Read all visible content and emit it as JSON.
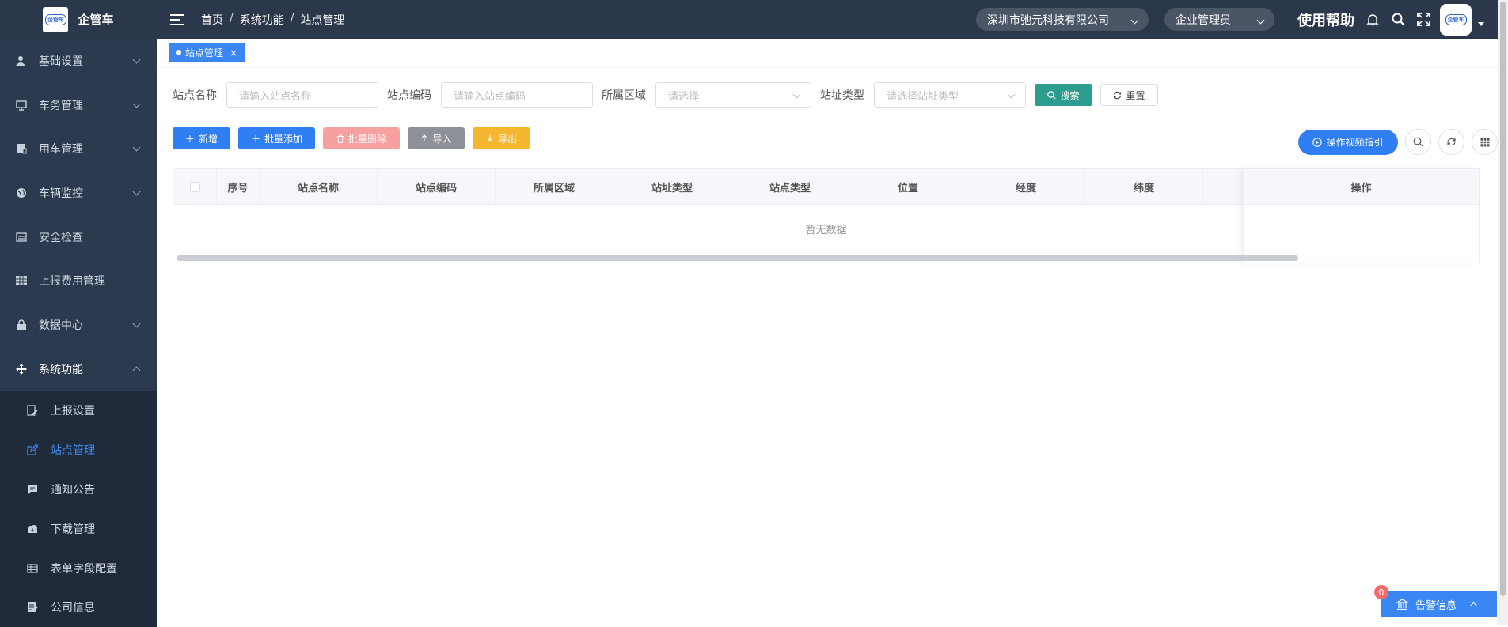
{
  "app": {
    "name": "企管车",
    "logo_text": "企管车"
  },
  "sidebar": {
    "items": [
      {
        "label": "基础设置",
        "icon": "user-icon"
      },
      {
        "label": "车务管理",
        "icon": "monitor-icon"
      },
      {
        "label": "用车管理",
        "icon": "car-doc-icon"
      },
      {
        "label": "车辆监控",
        "icon": "globe-icon"
      },
      {
        "label": "安全检查",
        "icon": "checklist-icon"
      },
      {
        "label": "上报费用管理",
        "icon": "grid-icon"
      },
      {
        "label": "数据中心",
        "icon": "lock-icon"
      },
      {
        "label": "系统功能",
        "icon": "move-icon"
      }
    ],
    "subitems": [
      {
        "label": "上报设置",
        "icon": "edit-doc-icon"
      },
      {
        "label": "站点管理",
        "icon": "edit-icon"
      },
      {
        "label": "通知公告",
        "icon": "message-icon"
      },
      {
        "label": "下载管理",
        "icon": "cloud-icon"
      },
      {
        "label": "表单字段配置",
        "icon": "table-icon"
      },
      {
        "label": "公司信息",
        "icon": "company-icon"
      }
    ]
  },
  "header": {
    "breadcrumb": [
      "首页",
      "系统功能",
      "站点管理"
    ],
    "company": "深圳市弛元科技有限公司",
    "role": "企业管理员",
    "help": "使用帮助"
  },
  "tabs": [
    {
      "label": "站点管理"
    }
  ],
  "filters": {
    "site_name_label": "站点名称",
    "site_name_placeholder": "请输入站点名称",
    "site_code_label": "站点编码",
    "site_code_placeholder": "请输入站点编码",
    "region_label": "所属区域",
    "region_placeholder": "请选择",
    "addr_type_label": "站址类型",
    "addr_type_placeholder": "请选择站址类型",
    "search": "搜索",
    "reset": "重置"
  },
  "toolbar": {
    "add": "新增",
    "batch_add": "批量添加",
    "batch_delete": "批量删除",
    "import": "导入",
    "export": "导出",
    "guide": "操作视频指引"
  },
  "table": {
    "columns": [
      "序号",
      "站点名称",
      "站点编码",
      "所属区域",
      "站址类型",
      "站点类型",
      "位置",
      "经度",
      "纬度"
    ],
    "action_column": "操作",
    "empty_text": "暂无数据"
  },
  "alarm": {
    "label": "告警信息",
    "count": "0"
  },
  "colors": {
    "accent": "#3a86f5",
    "sidebar_bg": "#2c3a4f",
    "search_btn": "#2c9c8f",
    "export_btn": "#f5b730"
  }
}
